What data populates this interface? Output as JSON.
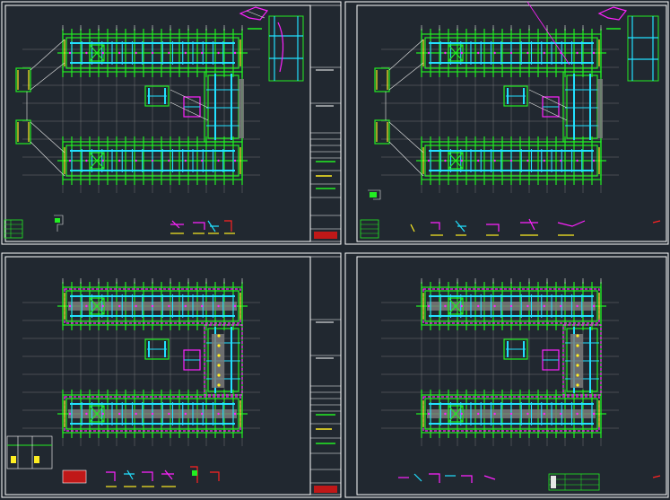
{
  "sheets": [
    {
      "id": "sheet-1",
      "label": "",
      "variant": "beam"
    },
    {
      "id": "sheet-2",
      "label": "",
      "variant": "beam"
    },
    {
      "id": "sheet-3",
      "label": "",
      "variant": "slab"
    },
    {
      "id": "sheet-4",
      "label": "",
      "variant": "slab"
    }
  ],
  "colors": {
    "background": "#212830",
    "frame": "#ffffff",
    "grid": "#8c8c8c",
    "wall": "#22ee22",
    "beam": "#22e0ff",
    "accent_magenta": "#ff22ff",
    "accent_yellow": "#ffee22",
    "accent_red": "#ff2222",
    "slab_hatch": "#7a7a7a"
  },
  "icons": [
    "title-block",
    "detail-callout",
    "legend-table",
    "leader-line"
  ]
}
